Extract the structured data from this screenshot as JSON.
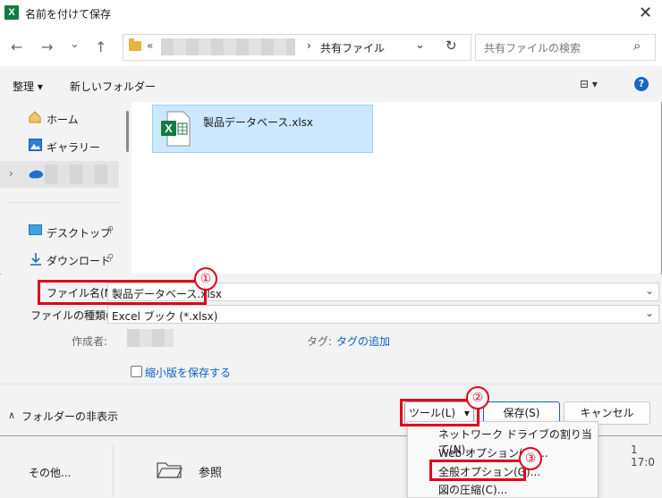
{
  "window": {
    "title": "名前を付けて保存",
    "app_badge": "X",
    "close_glyph": "✕"
  },
  "nav": {
    "back": "←",
    "forward": "→",
    "dropdown": "⌄",
    "up": "↑",
    "breadcrumb_prefix": "«",
    "breadcrumb_current": "共有ファイル",
    "address_chevron": "›",
    "address_dropdown": "⌄",
    "refresh": "↻",
    "search_placeholder": "共有ファイルの検索",
    "search_icon": "⌕"
  },
  "toolbar": {
    "organize": "整理 ▾",
    "new_folder": "新しいフォルダー",
    "view_icon": "⊟ ▾",
    "help": "?"
  },
  "sidebar": {
    "items": [
      {
        "label": "ホーム",
        "icon": "home-icon"
      },
      {
        "label": "ギャラリー",
        "icon": "gallery-icon"
      },
      {
        "label": "",
        "icon": "onedrive-icon"
      },
      {
        "label": "デスクトップ",
        "icon": "desktop-icon",
        "pin": "📌"
      },
      {
        "label": "ダウンロード",
        "icon": "download-icon",
        "pin": "📌"
      }
    ],
    "expand_chevron": "›"
  },
  "files": [
    {
      "name": "製品データベース.xlsx",
      "icon": "excel-file-icon",
      "selected": true
    }
  ],
  "form": {
    "filename_label": "ファイル名(N):",
    "filename_value": "製品データベース.xlsx",
    "filetype_label": "ファイルの種類(T):",
    "filetype_value": "Excel ブック (*.xlsx)",
    "author_label": "作成者:",
    "tags_label": "タグ:",
    "tags_link": "タグの追加",
    "thumbnail_label": "縮小版を保存する",
    "dropdown_glyph": "⌄"
  },
  "footer": {
    "hide_folders": "フォルダーの非表示",
    "hide_chevron": "∧",
    "tools_button": "ツール(L)",
    "tools_arrow": "▾",
    "save_button": "保存(S)",
    "cancel_button": "キャンセル"
  },
  "tools_menu": {
    "items": [
      "ネットワーク ドライブの割り当て(N)...",
      "Web オプション(W)...",
      "全般オプション(G)...",
      "図の圧縮(C)..."
    ]
  },
  "annotations": {
    "step1": "①",
    "step2": "②",
    "step3": "③",
    "color": "#e0001b"
  },
  "background_window": {
    "other": "その他...",
    "browse": "参照",
    "time": "1 17:0"
  }
}
